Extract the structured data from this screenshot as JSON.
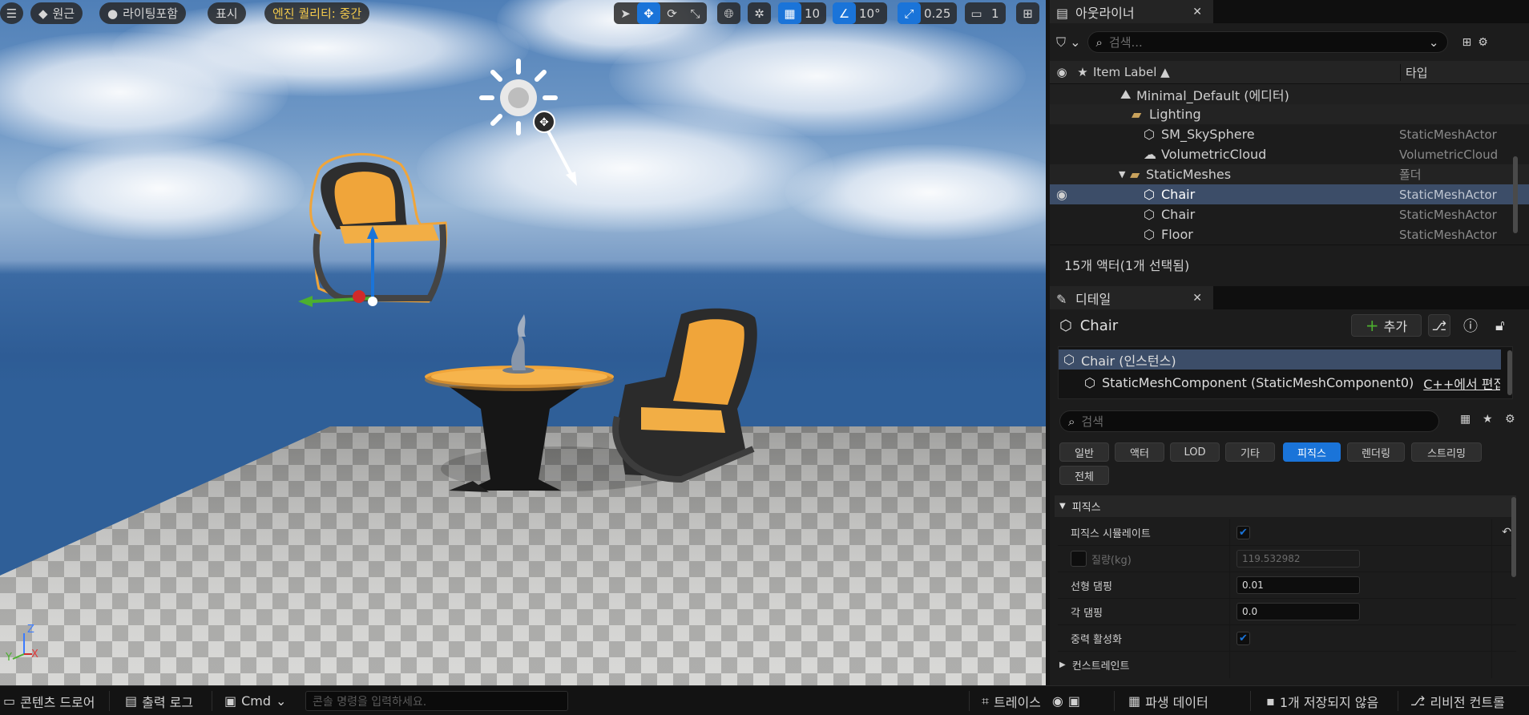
{
  "viewport": {
    "toolbar_left": {
      "perspective_label": "원근",
      "lighting_label": "라이팅포함",
      "show_label": "표시",
      "quality_label": "엔진 퀄리티: 중간"
    },
    "toolbar_right": {
      "grid_snap_value": "10",
      "rotation_snap_value": "10°",
      "scale_snap_value": "0.25",
      "camera_speed_value": "1"
    },
    "axis_labels": {
      "z": "Z",
      "x": "X",
      "y": "Y"
    }
  },
  "outliner": {
    "tab_label": "아웃라이너",
    "search_placeholder": "검색...",
    "columns": {
      "label": "Item Label ▲",
      "type": "타입"
    },
    "rows": [
      {
        "label": "Minimal_Default (에디터)",
        "type": ""
      },
      {
        "label": "Lighting",
        "type": ""
      },
      {
        "label": "SM_SkySphere",
        "type": "StaticMeshActor"
      },
      {
        "label": "VolumetricCloud",
        "type": "VolumetricCloud"
      },
      {
        "label": "StaticMeshes",
        "type": "폴더"
      },
      {
        "label": "Chair",
        "type": "StaticMeshActor"
      },
      {
        "label": "Chair",
        "type": "StaticMeshActor"
      },
      {
        "label": "Floor",
        "type": "StaticMeshActor"
      }
    ],
    "status": "15개 액터(1개 선택됨)"
  },
  "details": {
    "tab_label": "디테일",
    "actor_name": "Chair",
    "add_label": "추가",
    "components": [
      {
        "label": "Chair (인스턴스)"
      },
      {
        "label": "StaticMeshComponent (StaticMeshComponent0)",
        "extra": "C++에서 편집"
      }
    ],
    "search_placeholder": "검색",
    "filters": [
      "일반",
      "액터",
      "LOD",
      "기타",
      "피직스",
      "렌더링",
      "스트리밍",
      "전체"
    ],
    "active_filter": "피직스",
    "section_title": "피직스",
    "properties": [
      {
        "label": "피직스 시뮬레이트",
        "kind": "check",
        "checked": true
      },
      {
        "label": "질량(kg)",
        "kind": "number-disabled",
        "value": "119.532982"
      },
      {
        "label": "선형 댐핑",
        "kind": "number",
        "value": "0.01"
      },
      {
        "label": "각 댐핑",
        "kind": "number",
        "value": "0.0"
      },
      {
        "label": "중력 활성화",
        "kind": "check",
        "checked": true
      }
    ],
    "subsection": "컨스트레인트"
  },
  "statusbar": {
    "content_drawer": "콘텐츠 드로어",
    "output_log": "출력 로그",
    "cmd": "Cmd",
    "console_placeholder": "콘솔 명령을 입력하세요.",
    "trace": "트레이스",
    "derived_data": "파생 데이터",
    "unsaved": "1개 저장되지 않음",
    "revision": "리비전 컨트롤"
  },
  "colors": {
    "accent": "#1a74d9",
    "selection": "#3c4d68",
    "quality_text": "#f2c94c",
    "chair_orange": "#f0a53a"
  }
}
